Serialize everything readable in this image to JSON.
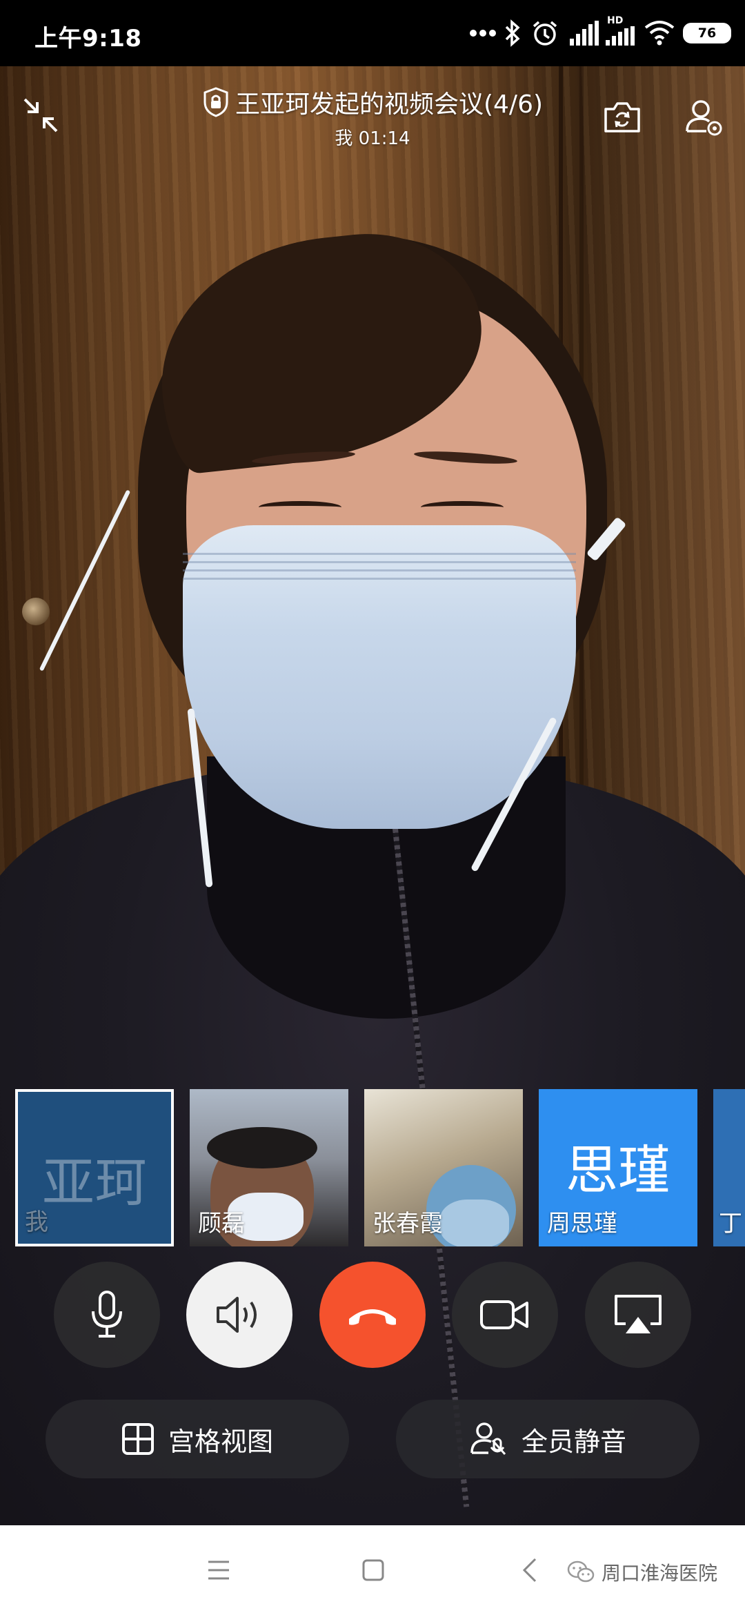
{
  "status_bar": {
    "time": "上午9:18",
    "battery": "76",
    "hd_badge": "HD"
  },
  "meeting": {
    "title": "王亚珂发起的视频会议(4/6)",
    "subtitle": "我 01:14"
  },
  "participants": [
    {
      "avatar_text": "亚珂",
      "name": "我",
      "selected": true
    },
    {
      "avatar_text": "",
      "name": "顾磊",
      "selected": false
    },
    {
      "avatar_text": "",
      "name": "张春霞",
      "selected": false
    },
    {
      "avatar_text": "思瑾",
      "name": "周思瑾",
      "selected": false
    },
    {
      "avatar_text": "",
      "name": "丁",
      "selected": false
    }
  ],
  "controls": {
    "grid_view_label": "宫格视图",
    "mute_all_label": "全员静音"
  },
  "watermark": {
    "text": "周口淮海医院"
  },
  "colors": {
    "end_call": "#f5522d",
    "accent_tile": "#2e8ff0",
    "self_tile": "#1f4f7d",
    "speaker_active": "#f1f1f1",
    "control_dark": "#2b2b2e"
  },
  "icons": [
    "minimize-icon",
    "shield-lock-icon",
    "switch-camera-icon",
    "add-member-icon",
    "microphone-icon",
    "speaker-icon",
    "hang-up-icon",
    "camera-icon",
    "screen-share-icon",
    "grid-icon",
    "mute-all-icon",
    "menu-icon",
    "home-icon",
    "back-icon",
    "wechat-icon"
  ]
}
